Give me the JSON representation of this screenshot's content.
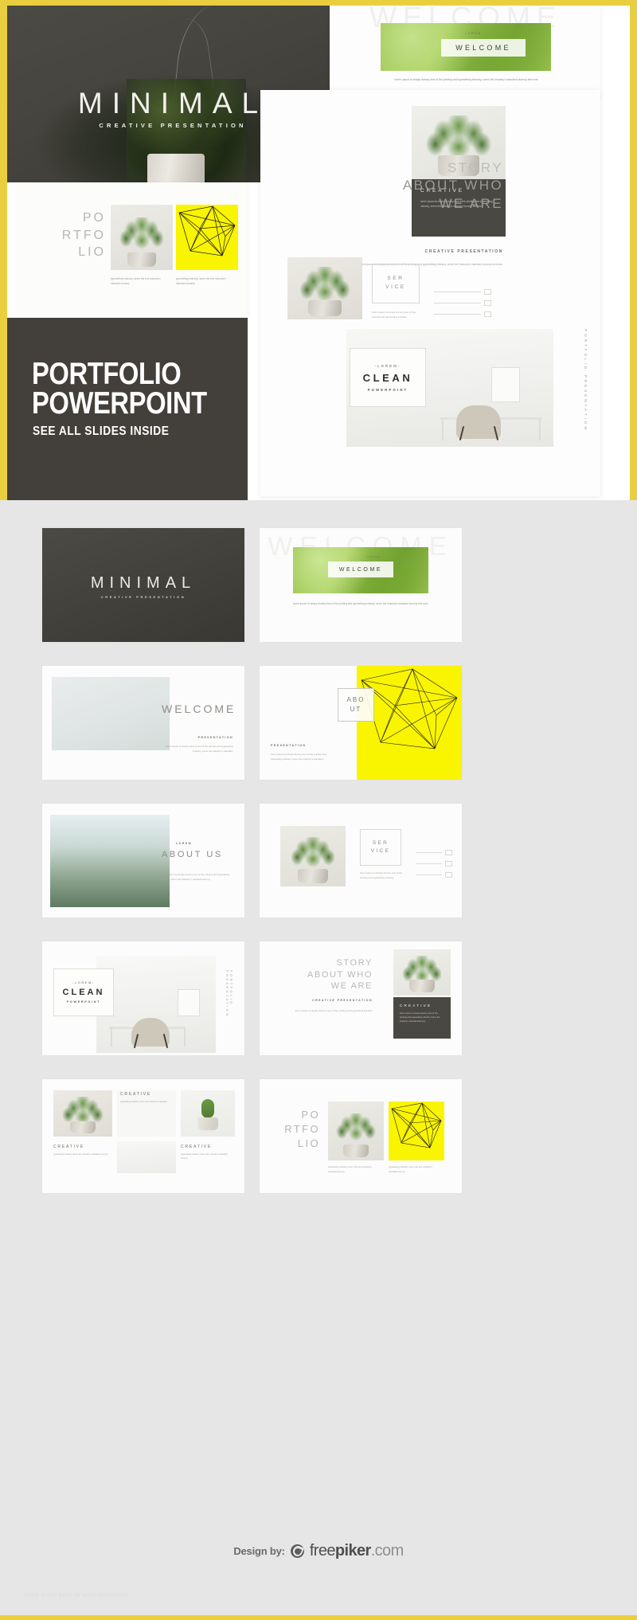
{
  "brand": {
    "accent_yellow": "#e9cf3f",
    "highlight_yellow": "#f9f400",
    "dark": "#433f3a",
    "page_bg": "#e6e6e6"
  },
  "hero": {
    "minimal": {
      "title": "MINIMAL",
      "subtitle": "CREATIVE PRESENTATION"
    },
    "welcome": {
      "ghost": "WELCOME",
      "lorem": "LOREM",
      "label": "WELCOME",
      "caption": "lorem ipsum is simply dummy text of the printing and typesetting industry, lorem the industry's standard dummy text ever."
    },
    "story": {
      "line1": "STORY",
      "line2": "ABOUT WHO",
      "line3": "WE ARE",
      "tag": "CREATIVE  PRESENTATION",
      "body": "lorem ipsum is simply dummy text of the printing and typesetting industry, lorem the industry's standard dummy text ever."
    },
    "creative_card": {
      "title": "CREATIVE",
      "body": "lorem ipsum is simply dummy text of the printing and typesetting industry, lorem the industry's standard dummy text ever."
    },
    "service": {
      "label_line1": "SER",
      "label_line2": "VICE",
      "body": "lorem ipsum is simply dummy text of the printing and typesetting industry."
    },
    "clean": {
      "lorem": "-LOREM-",
      "title": "CLEAN",
      "sub": "POWERPOINT",
      "vertical": "PORTFOLIO PRESENTATION"
    },
    "portfolio": {
      "line1": "PO",
      "line2": "RTFO",
      "line3": "LIO",
      "cap1": "typesetting industry, lorem the text industry's standard dummy",
      "cap2": "typesetting industry, lorem the text industry's standard dummy"
    },
    "promo": {
      "line1": "PORTFOLIO",
      "line2": "POWERPOINT",
      "line3": "SEE ALL SLIDES INSIDE"
    }
  },
  "grid": {
    "slide1": {
      "title": "MINIMAL",
      "subtitle": "CREATIVE PRESENTATION"
    },
    "slide2": {
      "ghost": "WELCOME",
      "lorem": "LOREM",
      "label": "WELCOME",
      "caption": "lorem ipsum is simply dummy text of the printing and typesetting industry, lorem the industry's standard dummy text ever."
    },
    "slide3": {
      "title": "WELCOME",
      "tag": "PRESENTATION",
      "body": "lorem ipsum is simply dummy text of the printing and typesetting industry, lorem the industry's standard."
    },
    "slide4": {
      "box_line1": "ABO",
      "box_line2": "UT",
      "tag": "PRESENTATION",
      "body": "lorem ipsum is simply dummy text of the printing and typesetting industry, lorem the industry's standard."
    },
    "slide5": {
      "lorem": "LOREM",
      "title": "ABOUT US",
      "body": "lorem ipsum is simply dummy text of the printing and typesetting industry, lorem the industry's standard dummy."
    },
    "slide6": {
      "label_line1": "SER",
      "label_line2": "VICE",
      "body": "lorem ipsum is simply dummy text of the printing and typesetting industry."
    },
    "slide7": {
      "lorem": "-LOREM-",
      "title": "CLEAN",
      "sub": "POWERPOINT",
      "vertical": "PORTFOLIO PRESENTATION"
    },
    "slide8": {
      "line1": "STORY",
      "line2": "ABOUT WHO",
      "line3": "WE ARE",
      "tag": "CREATIVE  PRESENTATION",
      "body": "lorem ipsum is simply dummy text of the printing and typesetting industry.",
      "card_title": "CREATIVE",
      "card_body": "lorem ipsum is simply dummy text of the printing and typesetting industry, lorem the industry's standard dummy."
    },
    "slide9": {
      "top_label": "CREATIVE",
      "top_sub": "typesetting industry, lorem the industry's standard",
      "left_label": "CREATIVE",
      "left_sub": "typesetting industry, lorem the industry's standard dummy",
      "right_label": "CREATIVE",
      "right_sub": "typesetting industry, lorem the industry's standard dummy"
    },
    "slide10": {
      "line1": "PO",
      "line2": "RTFO",
      "line3": "LIO",
      "cap1": "typesetting industry, lorem the text industry's standard dummy",
      "cap2": "typesetting industry, lorem the text industry's standard dummy"
    }
  },
  "footer": {
    "design_by": "Design by:",
    "logo_free": "free",
    "logo_piker": "piker",
    "logo_com": ".com",
    "watermark": "lorem ipsum dolor sit amet consectetur"
  }
}
